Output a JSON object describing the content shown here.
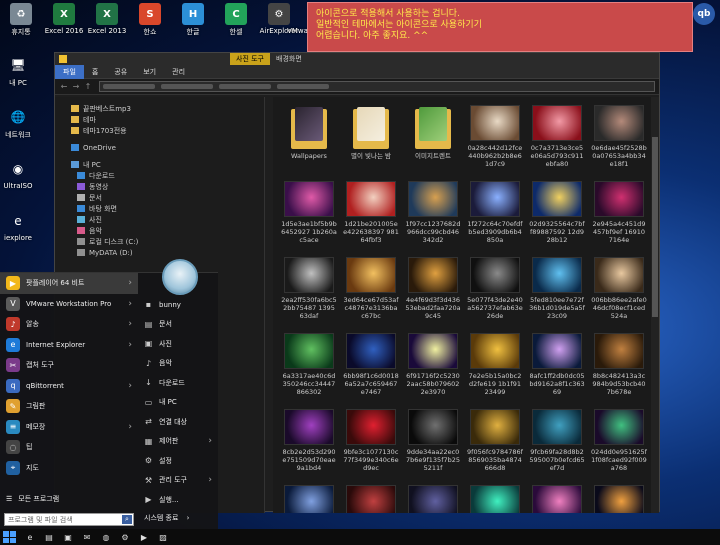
{
  "desktop_top_icons": [
    {
      "label": "휴지통",
      "icon": "recycle-bin-icon",
      "bg": "#7a8894",
      "glyph": "♻"
    },
    {
      "label": "Excel 2016",
      "icon": "excel-icon",
      "bg": "#1f7a3f",
      "glyph": "X"
    },
    {
      "label": "Excel 2013",
      "icon": "excel-icon",
      "bg": "#217346",
      "glyph": "X"
    },
    {
      "label": "한쇼",
      "icon": "hanshow-icon",
      "bg": "#d9472b",
      "glyph": "S"
    },
    {
      "label": "한글",
      "icon": "hangul-icon",
      "bg": "#2c8fd6",
      "glyph": "H"
    },
    {
      "label": "한셀",
      "icon": "hancell-icon",
      "bg": "#22a35a",
      "glyph": "C"
    },
    {
      "label": "AirExplorer",
      "icon": "gear-icon",
      "bg": "#444",
      "glyph": "⚙"
    },
    {
      "label": "VMware Workstati...",
      "icon": "vmware-icon",
      "bg": "#6b6b6b",
      "glyph": "V"
    }
  ],
  "desktop_right_icon": {
    "label": "qBittorrent",
    "glyph": "qb"
  },
  "desktop_left_icons": [
    {
      "label": "내 PC",
      "glyph": "🖥"
    },
    {
      "label": "네트워크",
      "glyph": "🌐"
    },
    {
      "label": "UltraISO",
      "glyph": "◉"
    },
    {
      "label": "iexplore",
      "glyph": "e"
    }
  ],
  "notice": {
    "line1": "아이콘으로 적용해서 사용하는 겁니다.",
    "line2": "일반적인 테마에서는 아이콘으로 사용하기기",
    "line3": "어렵습니다. 아주 좋지요. ^^"
  },
  "explorer": {
    "ribbon_tabs": [
      "파일",
      "홈",
      "공유",
      "보기",
      "관리"
    ],
    "context_tab": "사진 도구",
    "context_tab2": "배경화면",
    "nav_items": [
      {
        "label": "끝판베스트mp3",
        "type": "folder",
        "sub": false
      },
      {
        "label": "테마",
        "type": "folder",
        "sub": false
      },
      {
        "label": "테마1703전용",
        "type": "folder",
        "sub": false
      },
      {
        "label": "OneDrive",
        "type": "cloud",
        "sub": false
      },
      {
        "label": "내 PC",
        "type": "pc",
        "sub": false
      },
      {
        "label": "다운로드",
        "type": "down",
        "sub": true
      },
      {
        "label": "동영상",
        "type": "video",
        "sub": true
      },
      {
        "label": "문서",
        "type": "doc",
        "sub": true
      },
      {
        "label": "바탕 화면",
        "type": "desk",
        "sub": true
      },
      {
        "label": "사진",
        "type": "pic",
        "sub": true
      },
      {
        "label": "음악",
        "type": "music",
        "sub": true
      },
      {
        "label": "로컬 디스크 (C:)",
        "type": "disk",
        "sub": true
      },
      {
        "label": "MyDATA (D:)",
        "type": "disk",
        "sub": true
      }
    ],
    "files": [
      {
        "name": "Wallpapers",
        "kind": "folder",
        "c1": "#2b2430",
        "c2": "#6a5a78"
      },
      {
        "name": "별이 빛나는 밤",
        "kind": "folder",
        "c1": "#e6d8b8",
        "c2": "#f5efe0"
      },
      {
        "name": "이미지트렌트",
        "kind": "folder",
        "c1": "#4f9a3c",
        "c2": "#9fcf7a"
      },
      {
        "name": "0a28c442d12fce440b962b2b8e61d7c9",
        "kind": "img",
        "c1": "#6a4b33",
        "c2": "#e8d9c5"
      },
      {
        "name": "0c7a3713e3ce5e06a5d793c911ebfa80",
        "kind": "img",
        "c1": "#8a0f1a",
        "c2": "#f29aa6"
      },
      {
        "name": "0e6dae45f2528b0a07653a4bb34e18f1",
        "kind": "img",
        "c1": "#2a2a2a",
        "c2": "#b48a7a"
      },
      {
        "name": "1d5e3ae1bf5b9b6452927 1b260ac5ace",
        "kind": "img",
        "c1": "#3a0f4a",
        "c2": "#e05aa8"
      },
      {
        "name": "1d21be201005ee422638397 98164fbf3",
        "kind": "img",
        "c1": "#b02020",
        "c2": "#f2d0c0"
      },
      {
        "name": "1f97cc1237682d966dcc99cbd46342d2",
        "kind": "img",
        "c1": "#1f3a5a",
        "c2": "#d7a050"
      },
      {
        "name": "1f272c64c70efdfb5ed3909db6b4850a",
        "kind": "img",
        "c1": "#1b1b3a",
        "c2": "#8ab0ff"
      },
      {
        "name": "02d9325564c7bff89887592 12d928b12",
        "kind": "img",
        "c1": "#0d2a6a",
        "c2": "#f0d060"
      },
      {
        "name": "2e945a4c451d9457bf9ef 169107164e",
        "kind": "img",
        "c1": "#2a0a2a",
        "c2": "#d03070"
      },
      {
        "name": "2ea2ff530fa6bc52bb75487 1395 63daf",
        "kind": "img",
        "c1": "#1a1a1a",
        "c2": "#c0c0c0"
      },
      {
        "name": "3ed64ce67d53afc48767e3136bac67bc",
        "kind": "img",
        "c1": "#6a3a10",
        "c2": "#f2c060"
      },
      {
        "name": "4e4f69d3f3d43653ebad2faa720a9c45",
        "kind": "img",
        "c1": "#2a1a0a",
        "c2": "#e0a040"
      },
      {
        "name": "5e077f43de2e40a562737efab63e26de",
        "kind": "img",
        "c1": "#101010",
        "c2": "#8a8a8a"
      },
      {
        "name": "5fed810ee7e72f36b1d019de5a5f23c09",
        "kind": "img",
        "c1": "#0a2a4a",
        "c2": "#60c0f0"
      },
      {
        "name": "006bb86ee2afe046dcf08ecf1ced524a",
        "kind": "img",
        "c1": "#3a2a1a",
        "c2": "#e8c8a0"
      },
      {
        "name": "6a3317ae40c6d350246cc34447866302",
        "kind": "img",
        "c1": "#0a3a1a",
        "c2": "#60c060"
      },
      {
        "name": "6bb98f1c6d00186a52a7c659467e7467",
        "kind": "img",
        "c1": "#0a0a2a",
        "c2": "#3060c0"
      },
      {
        "name": "6f91716f2c52302aac58b0796022e3970",
        "kind": "img",
        "c1": "#1a0a3a",
        "c2": "#f0f0a0"
      },
      {
        "name": "7e2e5b15a0bc2d2fe619 1b1f9123499",
        "kind": "img",
        "c1": "#5a3a0a",
        "c2": "#f0c040"
      },
      {
        "name": "8afc1ff2db0dc05bd9162a8f1c36369",
        "kind": "img",
        "c1": "#0a1a3a",
        "c2": "#d0a0f0"
      },
      {
        "name": "8b8c482413a3c984b9d53bcb407b678e",
        "kind": "img",
        "c1": "#2a1a0a",
        "c2": "#c08040"
      },
      {
        "name": "8cb2e2d53d290e751509d70eae9a1bd4",
        "kind": "img",
        "c1": "#1a0a2a",
        "c2": "#a040c0"
      },
      {
        "name": "9bfe3c1077130c77f3499e340c6ed9ec",
        "kind": "img",
        "c1": "#3a0a0a",
        "c2": "#e02030"
      },
      {
        "name": "9dde34aa22ec07b6e9f135f7b255211f",
        "kind": "img",
        "c1": "#0a0a0a",
        "c2": "#707070"
      },
      {
        "name": "9f056fc9784786f8569035ba4874666d8",
        "kind": "img",
        "c1": "#3a2a0a",
        "c2": "#e0b040"
      },
      {
        "name": "9fcb69fa28d8b2595007b0efcd65ef7d",
        "kind": "img",
        "c1": "#0a2a3a",
        "c2": "#40a0c0"
      },
      {
        "name": "024dd0e951625f1f08fcaed92f009a768",
        "kind": "img",
        "c1": "#1a0a2a",
        "c2": "#40c080"
      },
      {
        "name": "28ee34295af3dc31e7945895d0981d6",
        "kind": "img",
        "c1": "#0a1a3a",
        "c2": "#80a0e0"
      },
      {
        "name": "35e64a9bbf38d78d01ec13b1bc6f77af",
        "kind": "img",
        "c1": "#2a0a0a",
        "c2": "#c04040"
      },
      {
        "name": "36e4dc5f62780098582e1e8686034f56",
        "kind": "img",
        "c1": "#101020",
        "c2": "#6060a0"
      },
      {
        "name": "041ae6a35de4e24874f335ce1e9f6718",
        "kind": "img",
        "c1": "#0a3a3a",
        "c2": "#40f0c0"
      },
      {
        "name": "42fe4e22a55095aafe2b8f12b2f6cf74",
        "kind": "img",
        "c1": "#2a0a3a",
        "c2": "#f080c0"
      },
      {
        "name": "71fd142f8f45edb6226ca6faf55d4771",
        "kind": "img",
        "c1": "#0a0a1a",
        "c2": "#f0a040"
      }
    ]
  },
  "start_menu": {
    "left_items": [
      {
        "label": "팟플레이어 64 비트",
        "icon": "potplayer-icon",
        "bg": "#f2b81a",
        "glyph": "▶",
        "arrow": true,
        "hl": true
      },
      {
        "label": "VMware Workstation Pro",
        "icon": "vmware-icon",
        "bg": "#5a5a5a",
        "glyph": "V",
        "arrow": true,
        "hl": false
      },
      {
        "label": "알송",
        "icon": "alsong-icon",
        "bg": "#c0392b",
        "glyph": "♪",
        "arrow": true,
        "hl": false
      },
      {
        "label": "Internet Explorer",
        "icon": "ie-icon",
        "bg": "#1e7ad8",
        "glyph": "e",
        "arrow": true,
        "hl": false
      },
      {
        "label": "캡처 도구",
        "icon": "snip-icon",
        "bg": "#7a3a8a",
        "glyph": "✂",
        "arrow": false,
        "hl": false
      },
      {
        "label": "qBittorrent",
        "icon": "qbittorrent-icon",
        "bg": "#3a6ac0",
        "glyph": "q",
        "arrow": true,
        "hl": false
      },
      {
        "label": "그림판",
        "icon": "paint-icon",
        "bg": "#e0a030",
        "glyph": "✎",
        "arrow": false,
        "hl": false
      },
      {
        "label": "메모장",
        "icon": "notepad-icon",
        "bg": "#2a8ac0",
        "glyph": "≡",
        "arrow": true,
        "hl": false
      },
      {
        "label": "팁",
        "icon": "tips-icon",
        "bg": "#444",
        "glyph": "◌",
        "arrow": false,
        "hl": false
      },
      {
        "label": "지도",
        "icon": "maps-icon",
        "bg": "#2060a0",
        "glyph": "⌖",
        "arrow": false,
        "hl": false
      }
    ],
    "all_programs": "모든 프로그램",
    "search_placeholder": "프로그램 및 파일 검색",
    "right_items": [
      {
        "label": "bunny",
        "glyph": "▪",
        "arrow": false
      },
      {
        "label": "문서",
        "glyph": "▤",
        "arrow": false
      },
      {
        "label": "사진",
        "glyph": "▣",
        "arrow": false
      },
      {
        "label": "음악",
        "glyph": "♪",
        "arrow": false
      },
      {
        "label": "다운로드",
        "glyph": "↓",
        "arrow": false
      },
      {
        "label": "내 PC",
        "glyph": "▭",
        "arrow": false
      },
      {
        "label": "연결 대상",
        "glyph": "⇄",
        "arrow": false
      },
      {
        "label": "제어판",
        "glyph": "▦",
        "arrow": true
      },
      {
        "label": "설정",
        "glyph": "⚙",
        "arrow": false
      },
      {
        "label": "관리 도구",
        "glyph": "⚒",
        "arrow": true
      },
      {
        "label": "실행...",
        "glyph": "▶",
        "arrow": false
      }
    ],
    "shutdown": "시스템 종료"
  },
  "taskbar_icons": [
    "ie-icon",
    "explorer-icon",
    "store-icon",
    "mail-icon",
    "chrome-icon",
    "settings-icon",
    "media-icon",
    "photo-icon"
  ]
}
